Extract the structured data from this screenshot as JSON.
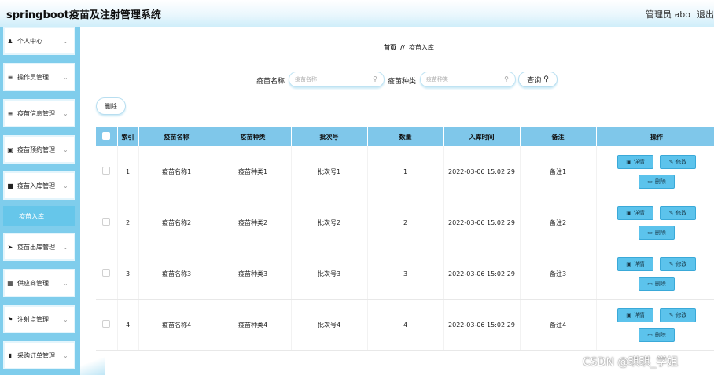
{
  "header": {
    "app_title": "springboot疫苗及注射管理系统",
    "admin_text": "管理员 abo",
    "logout_label": "退出"
  },
  "sidebar": {
    "items": [
      {
        "label": "个人中心",
        "icon": "person-icon"
      },
      {
        "label": "操作员管理",
        "icon": "list-icon"
      },
      {
        "label": "疫苗信息管理",
        "icon": "list-icon"
      },
      {
        "label": "疫苗预约管理",
        "icon": "box-icon"
      },
      {
        "label": "疫苗入库管理",
        "icon": "bag-icon"
      },
      {
        "label": "疫苗出库管理",
        "icon": "send-icon"
      },
      {
        "label": "供应商管理",
        "icon": "grid-icon"
      },
      {
        "label": "注射点管理",
        "icon": "flag-icon"
      },
      {
        "label": "采购订单管理",
        "icon": "clipboard-icon"
      }
    ],
    "active_sub": "疫苗入库"
  },
  "breadcrumb": {
    "home": "首页",
    "separator": "//",
    "current": "疫苗入库"
  },
  "search": {
    "name_label": "疫苗名称",
    "name_placeholder": "疫苗名称",
    "type_label": "疫苗种类",
    "type_placeholder": "疫苗种类",
    "query_label": "查询"
  },
  "toolbar": {
    "delete_label": "删除"
  },
  "table": {
    "columns": [
      "索引",
      "疫苗名称",
      "疫苗种类",
      "批次号",
      "数量",
      "入库时间",
      "备注",
      "操作"
    ],
    "rows": [
      {
        "index": "1",
        "name": "疫苗名称1",
        "type": "疫苗种类1",
        "batch": "批次号1",
        "qty": "1",
        "time": "2022-03-06 15:02:29",
        "note": "备注1"
      },
      {
        "index": "2",
        "name": "疫苗名称2",
        "type": "疫苗种类2",
        "batch": "批次号2",
        "qty": "2",
        "time": "2022-03-06 15:02:29",
        "note": "备注2"
      },
      {
        "index": "3",
        "name": "疫苗名称3",
        "type": "疫苗种类3",
        "batch": "批次号3",
        "qty": "3",
        "time": "2022-03-06 15:02:29",
        "note": "备注3"
      },
      {
        "index": "4",
        "name": "疫苗名称4",
        "type": "疫苗种类4",
        "batch": "批次号4",
        "qty": "4",
        "time": "2022-03-06 15:02:29",
        "note": "备注4"
      }
    ],
    "actions": {
      "detail": "详情",
      "edit": "修改",
      "delete": "删除"
    }
  },
  "watermark": "CSDN @琪琪_学姐",
  "colors": {
    "accent": "#7fcdec",
    "button": "#5cc3ec",
    "header_row": "#7fc7ea"
  }
}
